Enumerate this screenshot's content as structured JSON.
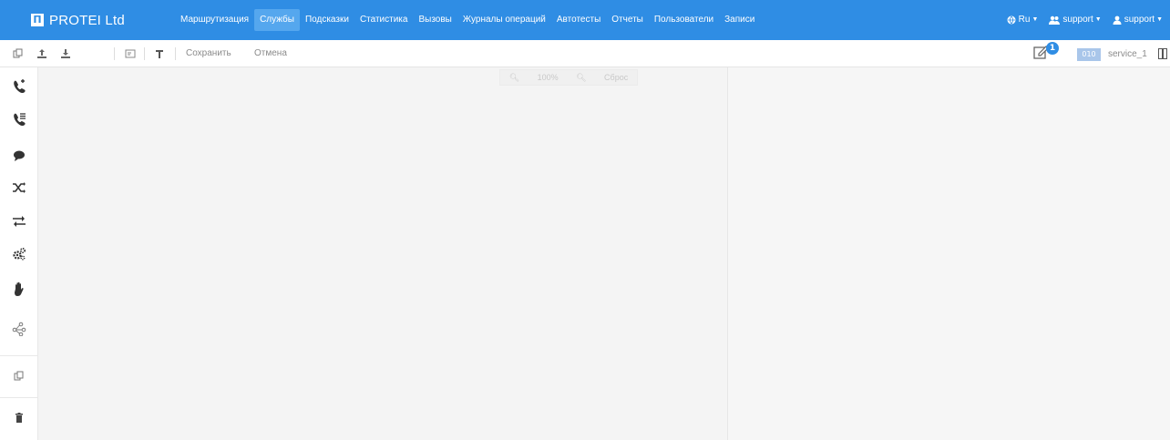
{
  "brand": {
    "name": "PROTEI Ltd",
    "logo_icon": "protei-logo"
  },
  "nav": {
    "items": [
      {
        "label": "Маршрутизация",
        "active": false
      },
      {
        "label": "Службы",
        "active": true
      },
      {
        "label": "Подсказки",
        "active": false
      },
      {
        "label": "Статистика",
        "active": false
      },
      {
        "label": "Вызовы",
        "active": false
      },
      {
        "label": "Журналы операций",
        "active": false
      },
      {
        "label": "Автотесты",
        "active": false
      },
      {
        "label": "Отчеты",
        "active": false
      },
      {
        "label": "Пользователи",
        "active": false
      },
      {
        "label": "Записи",
        "active": false
      }
    ],
    "language": "Ru",
    "user_menu_1": "support",
    "user_menu_2": "support"
  },
  "toolbar": {
    "save_label": "Сохранить",
    "cancel_label": "Отмена",
    "notification_count": "1",
    "service_tag": "010",
    "service_name": "service_1"
  },
  "zoom": {
    "level": "100%",
    "reset_label": "Сброс"
  },
  "colors": {
    "primary": "#2f8de4",
    "active_nav": "#55a7ee",
    "canvas": "#f4f4f4"
  }
}
